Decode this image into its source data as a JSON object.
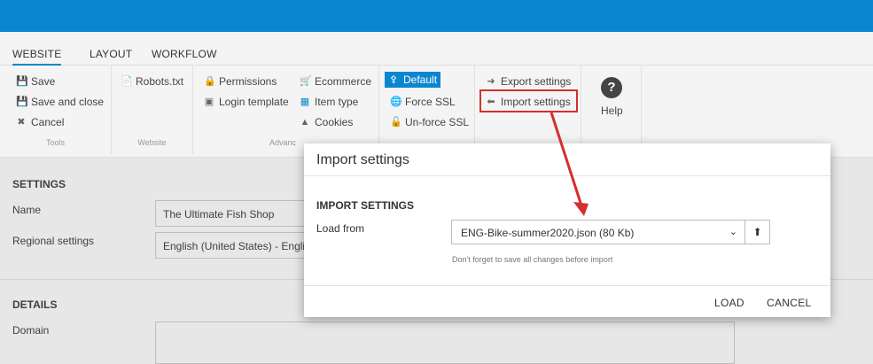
{
  "tabs": [
    {
      "label": "WEBSITE",
      "active": true
    },
    {
      "label": "LAYOUT"
    },
    {
      "label": "WORKFLOW"
    }
  ],
  "ribbon": {
    "tools": {
      "save": "Save",
      "save_close": "Save and close",
      "cancel": "Cancel",
      "group": "Tools"
    },
    "website": {
      "robots": "Robots.txt",
      "group": "Website"
    },
    "advanced": {
      "permissions": "Permissions",
      "login_template": "Login template",
      "ecommerce": "Ecommerce",
      "item_type": "Item type",
      "cookies": "Cookies",
      "group": "Advanc"
    },
    "ssl": {
      "default": "Default",
      "force_ssl": "Force SSL",
      "unforce_ssl": "Un-force SSL"
    },
    "settings": {
      "export": "Export settings",
      "import": "Import settings"
    },
    "help": {
      "label": "Help"
    }
  },
  "settings_section": {
    "title": "SETTINGS",
    "name_label": "Name",
    "name_value": "The Ultimate Fish Shop",
    "regional_label": "Regional settings",
    "regional_value": "English (United States) - English"
  },
  "details_section": {
    "title": "DETAILS",
    "domain_label": "Domain"
  },
  "modal": {
    "title": "Import settings",
    "section": "IMPORT SETTINGS",
    "load_from_label": "Load from",
    "selected_file": "ENG-Bike-summer2020.json (80 Kb)",
    "hint": "Don't forget to save all changes before import",
    "load_button": "LOAD",
    "cancel_button": "CANCEL"
  },
  "colors": {
    "accent": "#0a86cf",
    "annotation": "#d32f2f"
  }
}
